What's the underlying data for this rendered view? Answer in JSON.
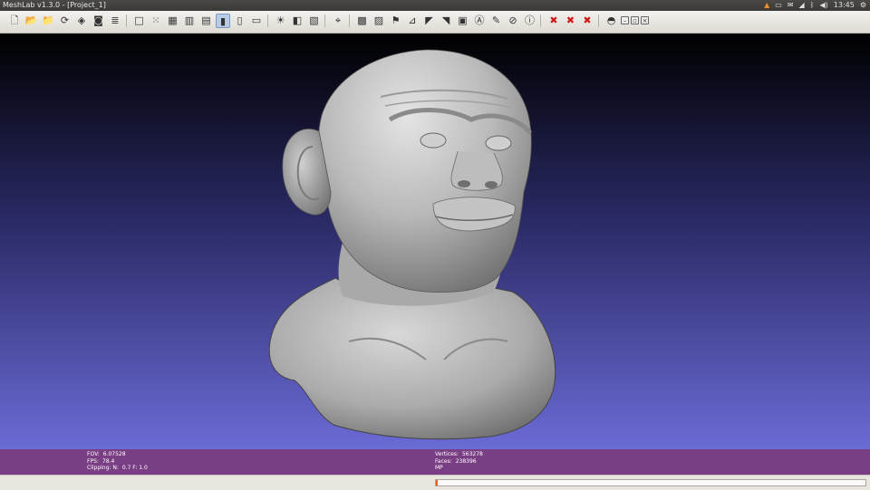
{
  "window": {
    "title": "MeshLab v1.3.0 - [Project_1]"
  },
  "system_tray": {
    "clock": "13:45"
  },
  "toolbar": {
    "groups": [
      [
        {
          "name": "new-project-button",
          "glyph": "🗋",
          "label": "New project"
        },
        {
          "name": "open-project-button",
          "glyph": "📂",
          "label": "Open project"
        },
        {
          "name": "import-mesh-button",
          "glyph": "📁",
          "label": "Import mesh"
        },
        {
          "name": "reload-button",
          "glyph": "⟳",
          "label": "Reload"
        },
        {
          "name": "export-mesh-button",
          "glyph": "◈",
          "label": "Export mesh"
        },
        {
          "name": "snapshot-button",
          "glyph": "◙",
          "label": "Snapshot"
        },
        {
          "name": "layers-button",
          "glyph": "≣",
          "label": "Layers"
        }
      ],
      [
        {
          "name": "bbox-render-button",
          "glyph": "□",
          "label": "Bounding box"
        },
        {
          "name": "points-render-button",
          "glyph": "⁙",
          "label": "Points"
        },
        {
          "name": "wireframe-render-button",
          "glyph": "▦",
          "label": "Wireframe"
        },
        {
          "name": "hidden-lines-render-button",
          "glyph": "▥",
          "label": "Hidden lines"
        },
        {
          "name": "flat-lines-render-button",
          "glyph": "▤",
          "label": "Flat lines"
        },
        {
          "name": "flat-render-button",
          "glyph": "▮",
          "label": "Flat",
          "active": true
        },
        {
          "name": "smooth-render-button",
          "glyph": "▯",
          "label": "Smooth"
        },
        {
          "name": "texture-render-button",
          "glyph": "▭",
          "label": "Texture"
        }
      ],
      [
        {
          "name": "light-button",
          "glyph": "☀",
          "label": "Light"
        },
        {
          "name": "backface-button",
          "glyph": "◧",
          "label": "Back-face culling"
        },
        {
          "name": "selected-faces-button",
          "glyph": "▧",
          "label": "Selected faces"
        }
      ],
      [
        {
          "name": "pick-points-button",
          "glyph": "⌖",
          "label": "Pick points"
        }
      ],
      [
        {
          "name": "info-filter-button",
          "glyph": "▩",
          "label": "Quality"
        },
        {
          "name": "colorize-button",
          "glyph": "▨",
          "label": "Colorize"
        },
        {
          "name": "align-button",
          "glyph": "⚑",
          "label": "Align"
        },
        {
          "name": "select-faces-button",
          "glyph": "⊿",
          "label": "Select faces"
        },
        {
          "name": "select-connected-button",
          "glyph": "◤",
          "label": "Select connected"
        },
        {
          "name": "select-vertex-button",
          "glyph": "◥",
          "label": "Select vertices"
        },
        {
          "name": "measure-button",
          "glyph": "▣",
          "label": "Measure"
        },
        {
          "name": "annotate-button",
          "glyph": "Ⓐ",
          "label": "Annotate"
        },
        {
          "name": "paint-button",
          "glyph": "✎",
          "label": "Paint"
        },
        {
          "name": "brush-button",
          "glyph": "⊘",
          "label": "Brush"
        },
        {
          "name": "info-button",
          "glyph": "ⓘ",
          "label": "Info"
        }
      ],
      [
        {
          "name": "delete-faces-button",
          "glyph": "✖",
          "label": "Delete faces"
        },
        {
          "name": "delete-vertices-button",
          "glyph": "✖",
          "label": "Delete vertices"
        },
        {
          "name": "delete-mixed-button",
          "glyph": "✖",
          "label": "Delete faces and vertices"
        }
      ],
      [
        {
          "name": "cursor-button",
          "glyph": "◓",
          "label": "Cursor"
        },
        {
          "name": "minimize-sub-button",
          "glyph": "–",
          "label": "Minimize",
          "small": true
        },
        {
          "name": "restore-sub-button",
          "glyph": "▫",
          "label": "Restore",
          "small": true
        },
        {
          "name": "close-sub-button",
          "glyph": "×",
          "label": "Close",
          "small": true
        }
      ]
    ]
  },
  "info_panel": {
    "left": [
      {
        "label": "FOV:",
        "value": "6.07528"
      },
      {
        "label": "FPS:",
        "value": "78.4"
      },
      {
        "label": "Clipping: N:",
        "value": "0.7 F:  1.0"
      }
    ],
    "right": [
      {
        "label": "Vertices:",
        "value": "563278"
      },
      {
        "label": "Faces:",
        "value": "238396"
      },
      {
        "label": "MP",
        "value": ""
      }
    ]
  },
  "progress": {
    "fraction": 0.004
  },
  "colors": {
    "viewport_top": "#000000",
    "viewport_bottom": "#6b6bd6",
    "info_bar": "#7a3e84",
    "progress_fill": "#e06020"
  }
}
